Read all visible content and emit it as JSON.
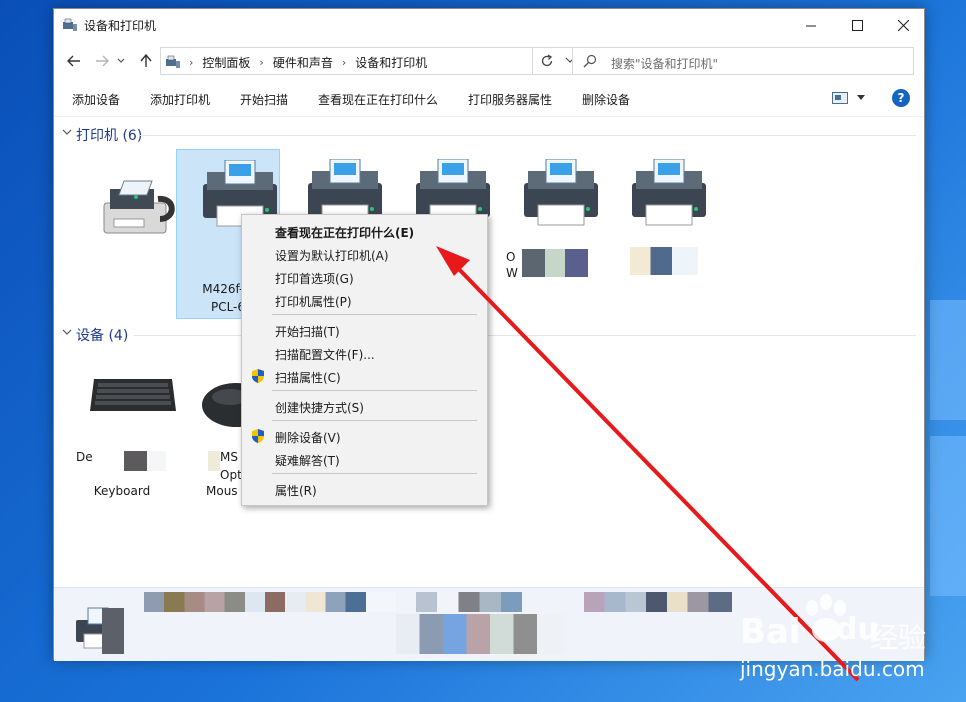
{
  "window": {
    "title": "设备和打印机",
    "minimize_icon": "minimize-icon",
    "maximize_icon": "maximize-icon",
    "close_icon": "close-icon"
  },
  "address_bar": {
    "breadcrumbs": [
      "控制面板",
      "硬件和声音",
      "设备和打印机"
    ],
    "search_placeholder": "搜索\"设备和打印机\""
  },
  "toolbar": {
    "items": [
      "添加设备",
      "添加打印机",
      "开始扫描",
      "查看现在正在打印什么",
      "打印服务器属性",
      "删除设备"
    ]
  },
  "groups": {
    "printers": {
      "title": "打印机 (6)"
    },
    "devices": {
      "title": "设备 (4)"
    }
  },
  "printers": [
    {
      "label": ""
    },
    {
      "label_line1": "M426f-M",
      "label_line2": "PCL-6"
    },
    {
      "label": ""
    },
    {
      "label": ""
    },
    {
      "label_line1": "O",
      "label_line2": "W"
    },
    {
      "label": ""
    }
  ],
  "devices": [
    {
      "label_line1": "De",
      "label_line2": "Keyboard"
    },
    {
      "label_line1": "MS",
      "label_line2": "Opt",
      "label_line3": "Mous"
    }
  ],
  "context_menu": {
    "items": [
      {
        "label": "查看现在正在打印什么(E)",
        "bold": true,
        "shield": false
      },
      {
        "label": "设置为默认打印机(A)",
        "shield": false
      },
      {
        "label": "打印首选项(G)",
        "shield": false
      },
      {
        "label": "打印机属性(P)",
        "shield": false
      },
      {
        "label": "开始扫描(T)",
        "shield": false
      },
      {
        "label": "扫描配置文件(F)...",
        "shield": false
      },
      {
        "label": "扫描属性(C)",
        "shield": true
      },
      {
        "label": "创建快捷方式(S)",
        "shield": false
      },
      {
        "label": "删除设备(V)",
        "shield": true
      },
      {
        "label": "疑难解答(T)",
        "shield": false
      },
      {
        "label": "属性(R)",
        "shield": false
      }
    ]
  },
  "watermark": {
    "brand": "Bai",
    "brand2": "du",
    "cn": "经验",
    "url": "jingyan.baidu.com"
  },
  "colors": {
    "annotation_arrow": "#e8191b",
    "selection": "#cce4f7",
    "group_title": "#1e3a8a"
  }
}
